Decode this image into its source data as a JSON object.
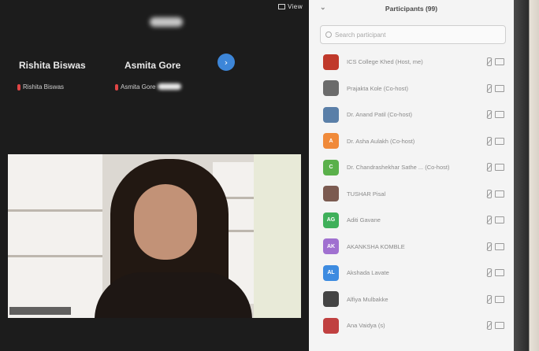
{
  "meeting": {
    "view_label": "View",
    "tiles": [
      {
        "display_name": "Rishita Biswas",
        "label": "Rishita Biswas"
      },
      {
        "display_name": "Asmita Gore",
        "label": "Asmita Gore"
      }
    ],
    "next_icon": "chevron-right-icon"
  },
  "panel": {
    "title": "Participants (99)",
    "search_placeholder": "Search participant",
    "participants": [
      {
        "name": "ICS College Khed (Host, me)",
        "color": "#c0392b",
        "initials": ""
      },
      {
        "name": "Prajakta Kole (Co-host)",
        "color": "#6b6b6b",
        "initials": ""
      },
      {
        "name": "Dr. Anand Patil (Co-host)",
        "color": "#5a7fa8",
        "initials": ""
      },
      {
        "name": "Dr. Asha Aulakh (Co-host)",
        "color": "#f08a3a",
        "initials": "A"
      },
      {
        "name": "Dr. Chandrashekhar Sathe ... (Co-host)",
        "color": "#5ab04a",
        "initials": "C"
      },
      {
        "name": "TUSHAR Pisal",
        "color": "#7b5a50",
        "initials": ""
      },
      {
        "name": "Aditi Gavane",
        "color": "#3fb05a",
        "initials": "AG"
      },
      {
        "name": "AKANKSHA KOMBLE",
        "color": "#a070d0",
        "initials": "AK"
      },
      {
        "name": "Akshada Lavate",
        "color": "#3d8be0",
        "initials": "AL"
      },
      {
        "name": "Alfiya Mulbakke",
        "color": "#444444",
        "initials": ""
      },
      {
        "name": "Ana Vaidya (s)",
        "color": "#c04040",
        "initials": ""
      }
    ]
  }
}
